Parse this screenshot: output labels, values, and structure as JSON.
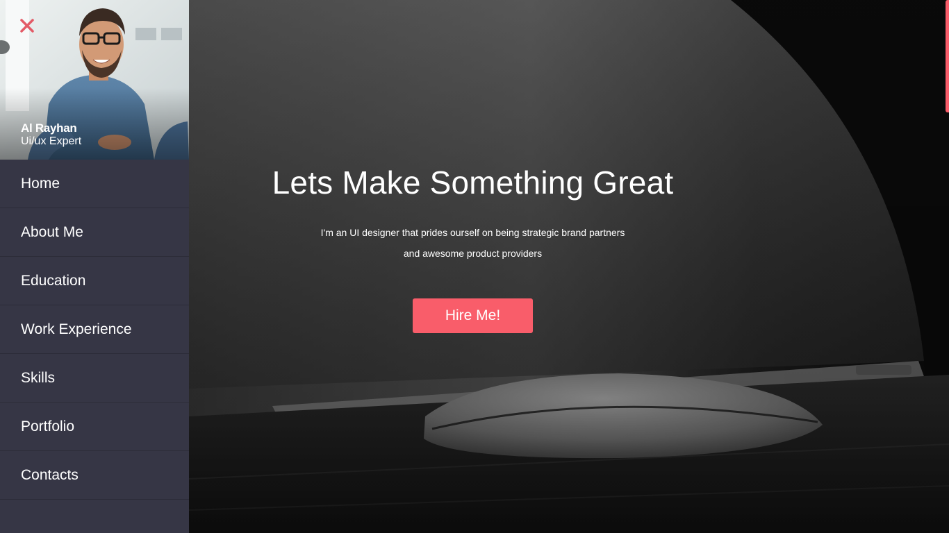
{
  "profile": {
    "name": "Al Rayhan",
    "role": "Ui/ux Expert"
  },
  "nav": {
    "items": [
      {
        "label": "Home"
      },
      {
        "label": "About Me"
      },
      {
        "label": "Education"
      },
      {
        "label": "Work Experience"
      },
      {
        "label": "Skills"
      },
      {
        "label": "Portfolio"
      },
      {
        "label": "Contacts"
      }
    ]
  },
  "hero": {
    "title": "Lets Make Something Great",
    "subtitle_line1": "I'm an UI designer that prides ourself on being strategic brand partners",
    "subtitle_line2": "and awesome product providers",
    "cta_label": "Hire Me!"
  },
  "icons": {
    "close": "close-icon"
  },
  "colors": {
    "accent": "#f95d6a",
    "sidebar_bg": "#363645",
    "text": "#ffffff"
  }
}
